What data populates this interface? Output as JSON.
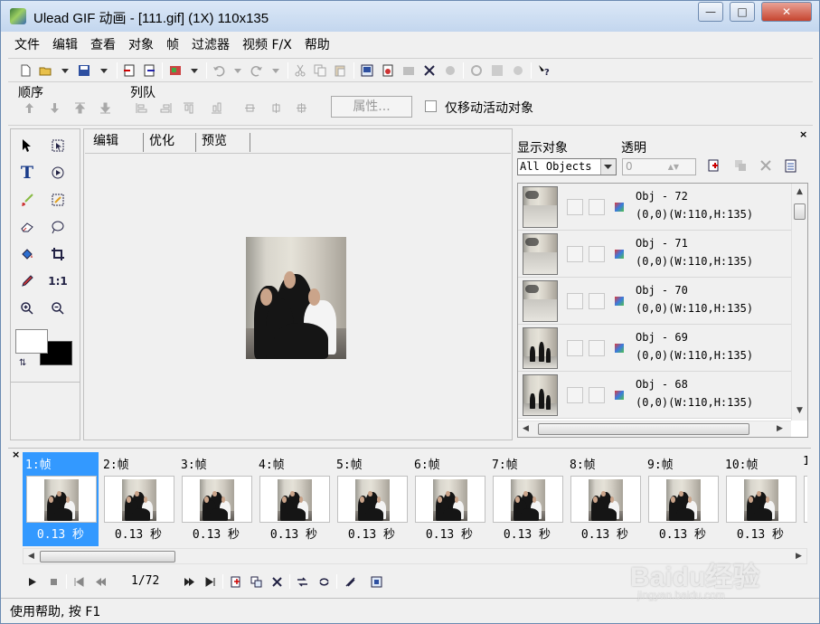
{
  "window": {
    "title": "Ulead GIF 动画 - [111.gif] (1X) 110x135",
    "minimize_glyph": "—",
    "maximize_glyph": "□",
    "close_glyph": "✕"
  },
  "menu": [
    "文件",
    "编辑",
    "查看",
    "对象",
    "帧",
    "过滤器",
    "视频 F/X",
    "帮助"
  ],
  "arrange": {
    "order_label": "顺序",
    "queue_label": "列队",
    "properties_button": "属性...",
    "move_active_only_label": "仅移动活动对象",
    "move_active_only_checked": false
  },
  "editor": {
    "tabs": [
      "编辑",
      "优化",
      "预览"
    ],
    "active_tab": "编辑"
  },
  "tools": [
    "pointer-tool",
    "marquee-tool",
    "text-tool",
    "magic-wand-tool",
    "brush-tool",
    "lasso-tool",
    "eraser-tool",
    "ellipse-select-tool",
    "fill-tool",
    "crop-tool",
    "eyedropper-tool",
    "actual-size-tool",
    "zoom-in-tool",
    "zoom-out-tool"
  ],
  "tool_glyphs": {
    "text-tool": "T",
    "actual-size-tool": "1:1"
  },
  "colors": {
    "foreground": "#ffffff",
    "background": "#000000",
    "selection": "#3399ff"
  },
  "object_panel": {
    "show_label": "显示对象",
    "show_value": "All Objects",
    "transparency_label": "透明",
    "transparency_value": "0",
    "objects": [
      {
        "name": "Obj - 72",
        "info": "(0,0)(W:110,H:135)"
      },
      {
        "name": "Obj - 71",
        "info": "(0,0)(W:110,H:135)"
      },
      {
        "name": "Obj - 70",
        "info": "(0,0)(W:110,H:135)"
      },
      {
        "name": "Obj - 69",
        "info": "(0,0)(W:110,H:135)"
      },
      {
        "name": "Obj - 68",
        "info": "(0,0)(W:110,H:135)"
      }
    ]
  },
  "frames": [
    {
      "label": "1:帧",
      "delay": "0.13 秒",
      "selected": true
    },
    {
      "label": "2:帧",
      "delay": "0.13 秒",
      "selected": false
    },
    {
      "label": "3:帧",
      "delay": "0.13 秒",
      "selected": false
    },
    {
      "label": "4:帧",
      "delay": "0.13 秒",
      "selected": false
    },
    {
      "label": "5:帧",
      "delay": "0.13 秒",
      "selected": false
    },
    {
      "label": "6:帧",
      "delay": "0.13 秒",
      "selected": false
    },
    {
      "label": "7:帧",
      "delay": "0.13 秒",
      "selected": false
    },
    {
      "label": "8:帧",
      "delay": "0.13 秒",
      "selected": false
    },
    {
      "label": "9:帧",
      "delay": "0.13 秒",
      "selected": false
    },
    {
      "label": "10:帧",
      "delay": "0.13 秒",
      "selected": false
    },
    {
      "label": "1",
      "delay": "",
      "selected": false
    }
  ],
  "playback": {
    "frame_counter": "1/72"
  },
  "status": {
    "text": "使用帮助, 按 F1"
  },
  "watermark": {
    "text": "Baidu经验",
    "sub": "jingyan.baidu.com"
  }
}
